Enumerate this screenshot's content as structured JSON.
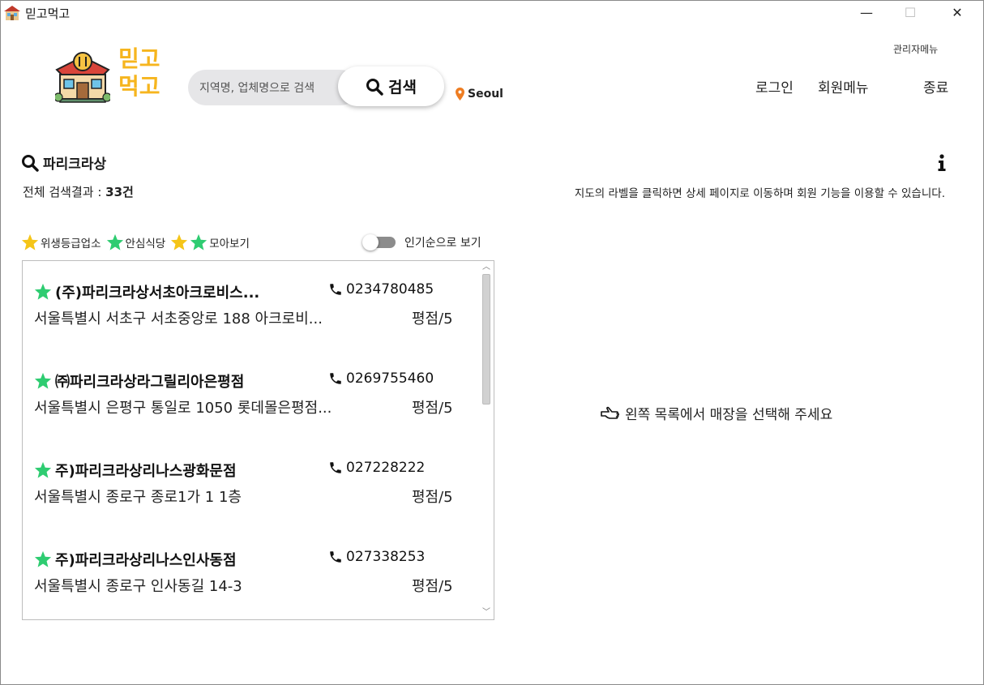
{
  "window": {
    "title": "믿고먹고",
    "minimize": "—",
    "maximize": "☐",
    "close": "✕"
  },
  "header": {
    "logo_line1": "믿고",
    "logo_line2": "먹고",
    "search_placeholder": "지역명, 업체명으로 검색",
    "search_button": "검색",
    "location": "Seoul",
    "admin_menu": "관리자메뉴",
    "nav": {
      "login": "로그인",
      "member_menu": "회원메뉴",
      "exit": "종료"
    }
  },
  "results": {
    "query": "파리크라상",
    "total_prefix": "전체 검색결과 : ",
    "total_count": "33건",
    "info_text": "지도의 라벨을 클릭하면 상세 페이지로 이동하며 회원 기능을 이용할 수 있습니다."
  },
  "filters": {
    "hygiene": "위생등급업소",
    "safe": "안심식당",
    "all": "모아보기",
    "sort_label": "인기순으로 보기",
    "sort_on": false
  },
  "colors": {
    "accent": "#f6b51e",
    "green_star": "#2ecc71",
    "yellow_star": "#f5c518"
  },
  "items": [
    {
      "name": "(주)파리크라상서초아크로비스...",
      "phone": "0234780485",
      "address": "서울특별시 서초구 서초중앙로 188 아크로비...",
      "rating": "평점/5"
    },
    {
      "name": "㈜파리크라상라그릴리아은평점",
      "phone": "0269755460",
      "address": "서울특별시 은평구 통일로 1050 롯데몰은평점...",
      "rating": "평점/5"
    },
    {
      "name": "주)파리크라상리나스광화문점",
      "phone": "027228222",
      "address": "서울특별시 종로구 종로1가 1 1층",
      "rating": "평점/5"
    },
    {
      "name": "주)파리크라상리나스인사동점",
      "phone": "027338253",
      "address": "서울특별시 종로구 인사동길 14-3",
      "rating": "평점/5"
    }
  ],
  "detail": {
    "placeholder": "왼쪽 목록에서 매장을 선택해 주세요"
  }
}
